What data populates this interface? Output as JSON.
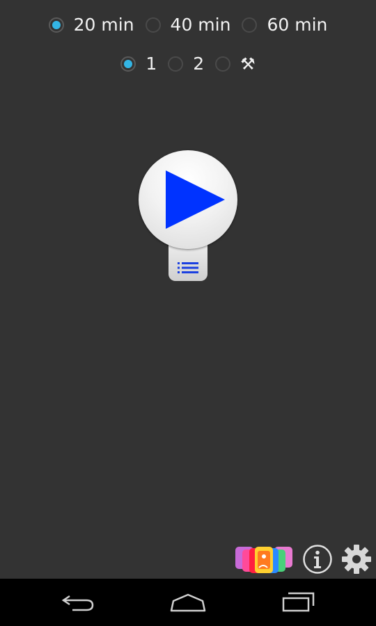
{
  "duration": {
    "options": [
      {
        "label": "20 min",
        "selected": true
      },
      {
        "label": "40 min",
        "selected": false
      },
      {
        "label": "60 min",
        "selected": false
      }
    ]
  },
  "mode": {
    "options": [
      {
        "label": "1",
        "selected": true
      },
      {
        "label": "2",
        "selected": false
      }
    ],
    "custom_option_icon": "tools-icon"
  },
  "player": {
    "play_icon": "play-icon",
    "list_icon": "list-icon",
    "play_color": "#0033ff"
  },
  "toolbar": {
    "icons": [
      "app-gallery-icon",
      "info-icon",
      "gear-icon"
    ]
  },
  "navigation": {
    "icons": [
      "back-icon",
      "home-icon",
      "recent-apps-icon"
    ]
  },
  "colors": {
    "background": "#333333",
    "accent": "#33b5e5",
    "nav_bar": "#000000"
  }
}
